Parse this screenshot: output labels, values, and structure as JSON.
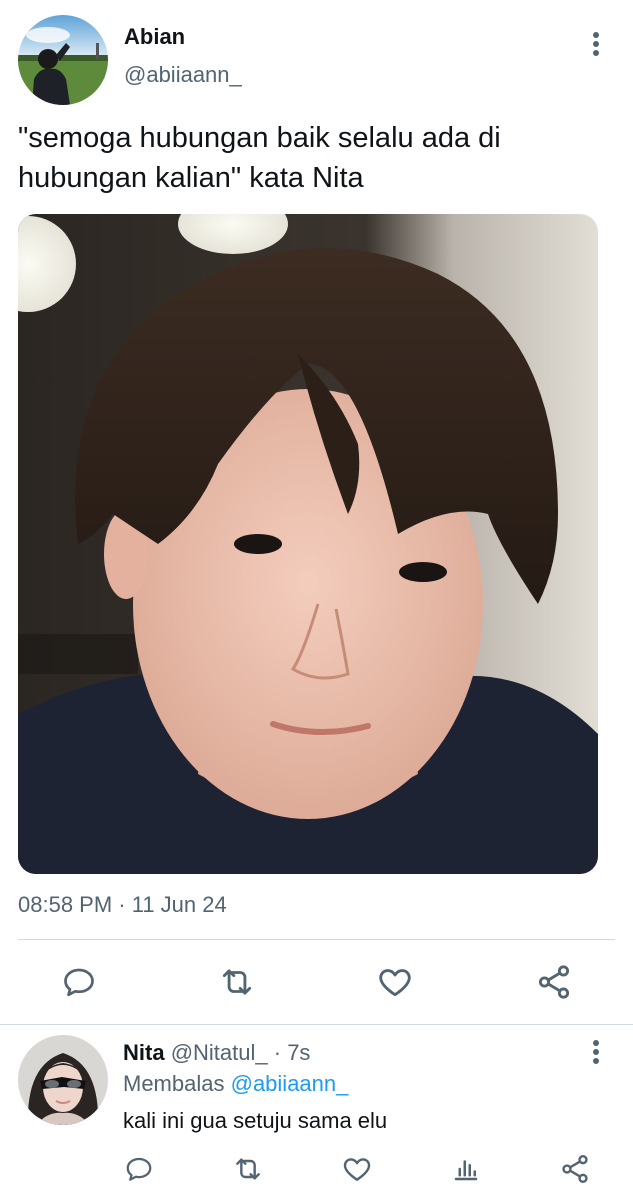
{
  "tweet": {
    "author_name": "Abian",
    "author_handle": "@abiiaann_",
    "text_line1": "\"semoga hubungan baik selalu ada di",
    "text_line2": "hubungan kalian\" kata Nita",
    "timestamp": "08:58 PM · 11 Jun 24",
    "actions": [
      "reply-icon",
      "retweet-icon",
      "like-icon",
      "share-icon"
    ]
  },
  "reply": {
    "author_name": "Nita",
    "author_handle": "@Nitatul_",
    "time": "· 7s",
    "replying_prefix": "Membalas",
    "replying_mention": "@abiiaann_",
    "text": "kali ini gua setuju sama elu",
    "actions": [
      "reply-icon",
      "retweet-icon",
      "like-icon",
      "views-icon",
      "share-icon"
    ]
  },
  "colors": {
    "text_primary": "#0f1419",
    "text_secondary": "#536471",
    "link": "#1d9bf0",
    "divider": "#cfd9de"
  }
}
